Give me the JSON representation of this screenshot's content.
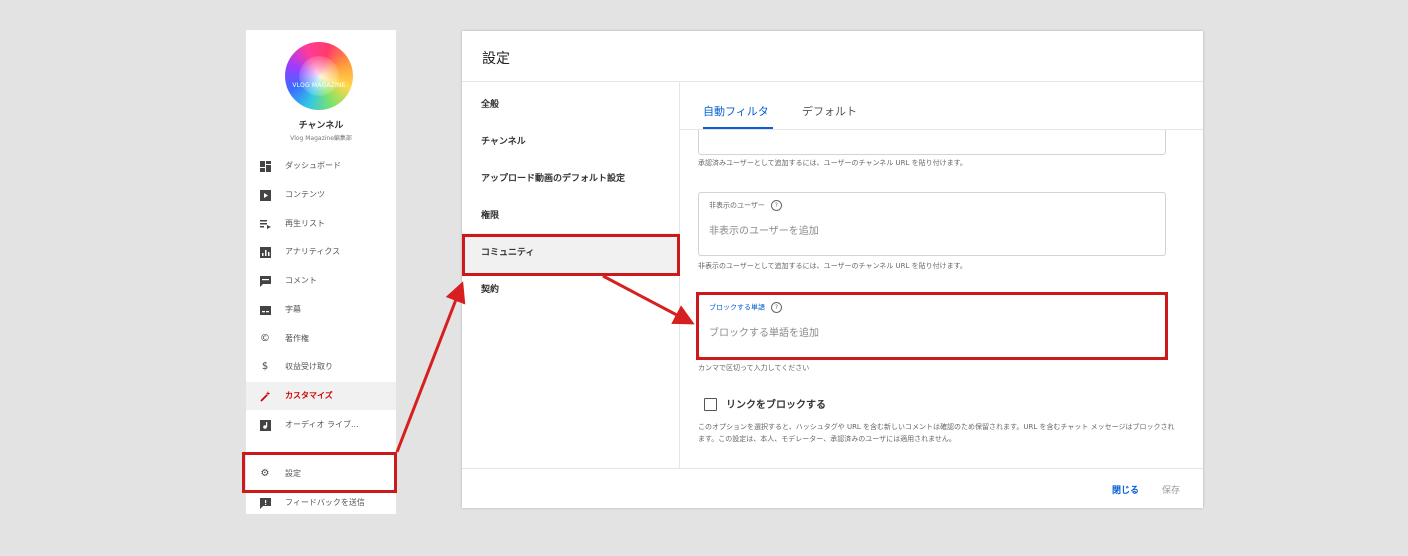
{
  "sidebar": {
    "avatar_brand": "VLOG MAGAZINE",
    "channel_title": "チャンネル",
    "channel_subtitle": "Vlog Magazine編集部",
    "items": [
      {
        "label": "ダッシュボード",
        "icon": "dashboard-icon"
      },
      {
        "label": "コンテンツ",
        "icon": "video-library-icon"
      },
      {
        "label": "再生リスト",
        "icon": "playlist-icon"
      },
      {
        "label": "アナリティクス",
        "icon": "analytics-icon"
      },
      {
        "label": "コメント",
        "icon": "comment-icon"
      },
      {
        "label": "字幕",
        "icon": "subtitles-icon"
      },
      {
        "label": "著作権",
        "icon": "copyright-icon"
      },
      {
        "label": "収益受け取り",
        "icon": "dollar-icon"
      },
      {
        "label": "カスタマイズ",
        "icon": "magic-wand-icon",
        "active": true
      },
      {
        "label": "オーディオ ライブ...",
        "icon": "audio-library-icon"
      },
      {
        "label": "設定",
        "icon": "gear-icon"
      },
      {
        "label": "フィードバックを送信",
        "icon": "feedback-icon"
      }
    ]
  },
  "dialog": {
    "title": "設定",
    "menu": [
      "全般",
      "チャンネル",
      "アップロード動画のデフォルト設定",
      "権限",
      "コミュニティ",
      "契約"
    ],
    "active_menu": "コミュニティ",
    "tabs": [
      "自動フィルタ",
      "デフォルト"
    ],
    "active_tab": "自動フィルタ",
    "approved_hint": "承認済みユーザーとして追加するには、ユーザーのチャンネル URL を貼り付けます。",
    "hidden_users": {
      "label": "非表示のユーザー",
      "placeholder": "非表示のユーザーを追加",
      "hint": "非表示のユーザーとして追加するには、ユーザーのチャンネル URL を貼り付けます。"
    },
    "blocked_words": {
      "label": "ブロックする単語",
      "placeholder": "ブロックする単語を追加",
      "hint": "カンマで区切って入力してください"
    },
    "block_links": {
      "label": "リンクをブロックする",
      "checked": false,
      "description": "このオプションを選択すると、ハッシュタグや URL を含む新しいコメントは確認のため保留されます。URL を含むチャット メッセージはブロックされます。この設定は、本人、モデレーター、承認済みのユーザには適用されません。"
    },
    "close_label": "閉じる",
    "save_label": "保存"
  },
  "colors": {
    "accent_blue": "#065fd4",
    "highlight_red": "#cc1a1a",
    "active_red": "#cc0000"
  }
}
